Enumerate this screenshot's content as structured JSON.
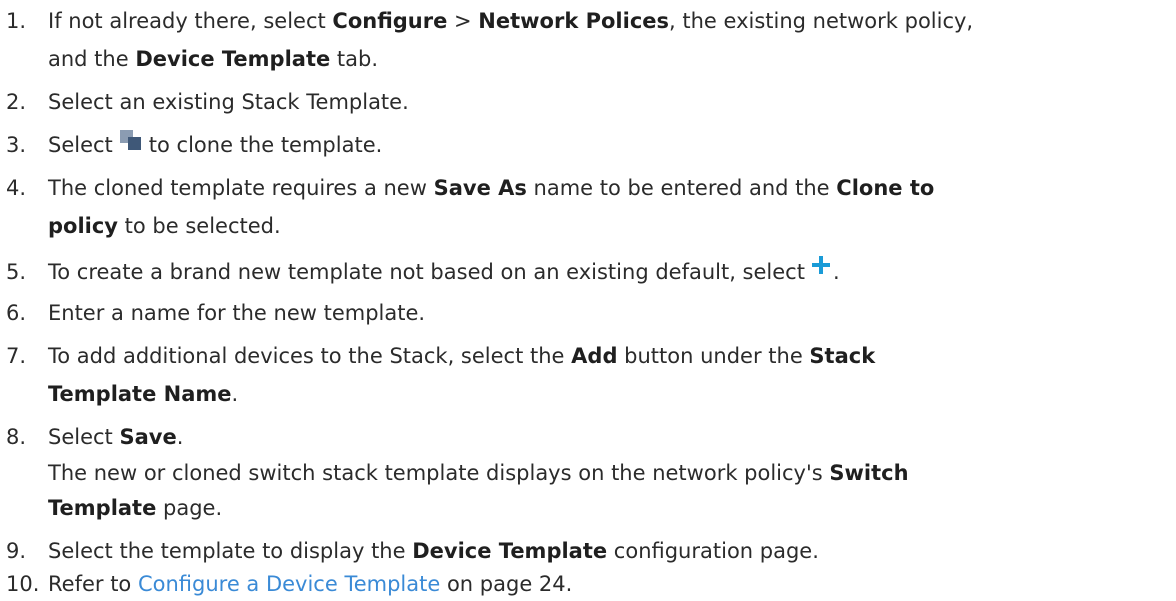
{
  "steps": [
    {
      "num": "1.",
      "line1": [
        "If not already there, select ",
        "Configure",
        " > ",
        "Network Polices",
        ", the existing network policy,"
      ],
      "line2": [
        "and the ",
        "Device Template",
        " tab."
      ]
    },
    {
      "num": "2.",
      "line1": [
        "Select an existing Stack Template."
      ]
    },
    {
      "num": "3.",
      "line1": [
        "Select",
        "to clone the template."
      ],
      "icon": "clone-icon"
    },
    {
      "num": "4.",
      "line1": [
        "The cloned template requires a new ",
        "Save As",
        " name to be entered and the ",
        "Clone to"
      ],
      "line2": [
        "policy",
        " to be selected."
      ]
    },
    {
      "num": "5.",
      "line1": [
        "To create a brand new template not based on an existing default, select",
        "."
      ],
      "icon": "add-icon"
    },
    {
      "num": "6.",
      "line1": [
        "Enter a name for the new template."
      ]
    },
    {
      "num": "7.",
      "line1": [
        "To add additional devices to the Stack, select the ",
        "Add",
        " button under the ",
        "Stack"
      ],
      "line2": [
        "Template Name",
        "."
      ]
    },
    {
      "num": "8.",
      "line1": [
        "Select ",
        "Save",
        "."
      ],
      "line2": [
        "The new or cloned switch stack template displays on the network policy's ",
        "Switch"
      ],
      "line3": [
        "Template",
        " page."
      ]
    },
    {
      "num": "9.",
      "line1": [
        "Select the template to display the ",
        "Device Template",
        " configuration page."
      ]
    },
    {
      "num": "10.",
      "line1": [
        "Refer to ",
        "Configure a Device Template",
        " on page 24."
      ]
    }
  ],
  "colors": {
    "text": "#2b2b2b",
    "link": "#3a8ad6",
    "plus_icon": "#1a9bd7",
    "clone_icon_back": "#8b9cb2",
    "clone_icon_front": "#3f5878"
  }
}
